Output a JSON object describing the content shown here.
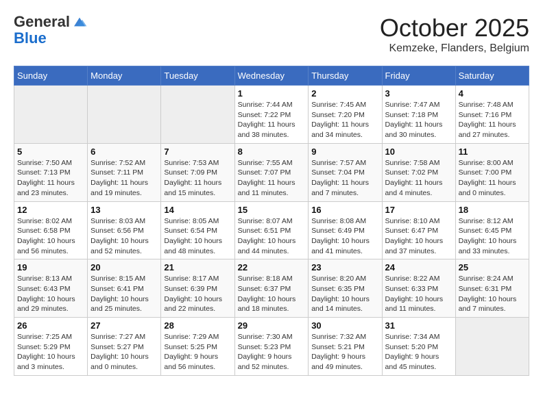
{
  "header": {
    "logo_general": "General",
    "logo_blue": "Blue",
    "month": "October 2025",
    "location": "Kemzeke, Flanders, Belgium"
  },
  "weekdays": [
    "Sunday",
    "Monday",
    "Tuesday",
    "Wednesday",
    "Thursday",
    "Friday",
    "Saturday"
  ],
  "weeks": [
    [
      {
        "day": "",
        "info": ""
      },
      {
        "day": "",
        "info": ""
      },
      {
        "day": "",
        "info": ""
      },
      {
        "day": "1",
        "info": "Sunrise: 7:44 AM\nSunset: 7:22 PM\nDaylight: 11 hours and 38 minutes."
      },
      {
        "day": "2",
        "info": "Sunrise: 7:45 AM\nSunset: 7:20 PM\nDaylight: 11 hours and 34 minutes."
      },
      {
        "day": "3",
        "info": "Sunrise: 7:47 AM\nSunset: 7:18 PM\nDaylight: 11 hours and 30 minutes."
      },
      {
        "day": "4",
        "info": "Sunrise: 7:48 AM\nSunset: 7:16 PM\nDaylight: 11 hours and 27 minutes."
      }
    ],
    [
      {
        "day": "5",
        "info": "Sunrise: 7:50 AM\nSunset: 7:13 PM\nDaylight: 11 hours and 23 minutes."
      },
      {
        "day": "6",
        "info": "Sunrise: 7:52 AM\nSunset: 7:11 PM\nDaylight: 11 hours and 19 minutes."
      },
      {
        "day": "7",
        "info": "Sunrise: 7:53 AM\nSunset: 7:09 PM\nDaylight: 11 hours and 15 minutes."
      },
      {
        "day": "8",
        "info": "Sunrise: 7:55 AM\nSunset: 7:07 PM\nDaylight: 11 hours and 11 minutes."
      },
      {
        "day": "9",
        "info": "Sunrise: 7:57 AM\nSunset: 7:04 PM\nDaylight: 11 hours and 7 minutes."
      },
      {
        "day": "10",
        "info": "Sunrise: 7:58 AM\nSunset: 7:02 PM\nDaylight: 11 hours and 4 minutes."
      },
      {
        "day": "11",
        "info": "Sunrise: 8:00 AM\nSunset: 7:00 PM\nDaylight: 11 hours and 0 minutes."
      }
    ],
    [
      {
        "day": "12",
        "info": "Sunrise: 8:02 AM\nSunset: 6:58 PM\nDaylight: 10 hours and 56 minutes."
      },
      {
        "day": "13",
        "info": "Sunrise: 8:03 AM\nSunset: 6:56 PM\nDaylight: 10 hours and 52 minutes."
      },
      {
        "day": "14",
        "info": "Sunrise: 8:05 AM\nSunset: 6:54 PM\nDaylight: 10 hours and 48 minutes."
      },
      {
        "day": "15",
        "info": "Sunrise: 8:07 AM\nSunset: 6:51 PM\nDaylight: 10 hours and 44 minutes."
      },
      {
        "day": "16",
        "info": "Sunrise: 8:08 AM\nSunset: 6:49 PM\nDaylight: 10 hours and 41 minutes."
      },
      {
        "day": "17",
        "info": "Sunrise: 8:10 AM\nSunset: 6:47 PM\nDaylight: 10 hours and 37 minutes."
      },
      {
        "day": "18",
        "info": "Sunrise: 8:12 AM\nSunset: 6:45 PM\nDaylight: 10 hours and 33 minutes."
      }
    ],
    [
      {
        "day": "19",
        "info": "Sunrise: 8:13 AM\nSunset: 6:43 PM\nDaylight: 10 hours and 29 minutes."
      },
      {
        "day": "20",
        "info": "Sunrise: 8:15 AM\nSunset: 6:41 PM\nDaylight: 10 hours and 25 minutes."
      },
      {
        "day": "21",
        "info": "Sunrise: 8:17 AM\nSunset: 6:39 PM\nDaylight: 10 hours and 22 minutes."
      },
      {
        "day": "22",
        "info": "Sunrise: 8:18 AM\nSunset: 6:37 PM\nDaylight: 10 hours and 18 minutes."
      },
      {
        "day": "23",
        "info": "Sunrise: 8:20 AM\nSunset: 6:35 PM\nDaylight: 10 hours and 14 minutes."
      },
      {
        "day": "24",
        "info": "Sunrise: 8:22 AM\nSunset: 6:33 PM\nDaylight: 10 hours and 11 minutes."
      },
      {
        "day": "25",
        "info": "Sunrise: 8:24 AM\nSunset: 6:31 PM\nDaylight: 10 hours and 7 minutes."
      }
    ],
    [
      {
        "day": "26",
        "info": "Sunrise: 7:25 AM\nSunset: 5:29 PM\nDaylight: 10 hours and 3 minutes."
      },
      {
        "day": "27",
        "info": "Sunrise: 7:27 AM\nSunset: 5:27 PM\nDaylight: 10 hours and 0 minutes."
      },
      {
        "day": "28",
        "info": "Sunrise: 7:29 AM\nSunset: 5:25 PM\nDaylight: 9 hours and 56 minutes."
      },
      {
        "day": "29",
        "info": "Sunrise: 7:30 AM\nSunset: 5:23 PM\nDaylight: 9 hours and 52 minutes."
      },
      {
        "day": "30",
        "info": "Sunrise: 7:32 AM\nSunset: 5:21 PM\nDaylight: 9 hours and 49 minutes."
      },
      {
        "day": "31",
        "info": "Sunrise: 7:34 AM\nSunset: 5:20 PM\nDaylight: 9 hours and 45 minutes."
      },
      {
        "day": "",
        "info": ""
      }
    ]
  ]
}
